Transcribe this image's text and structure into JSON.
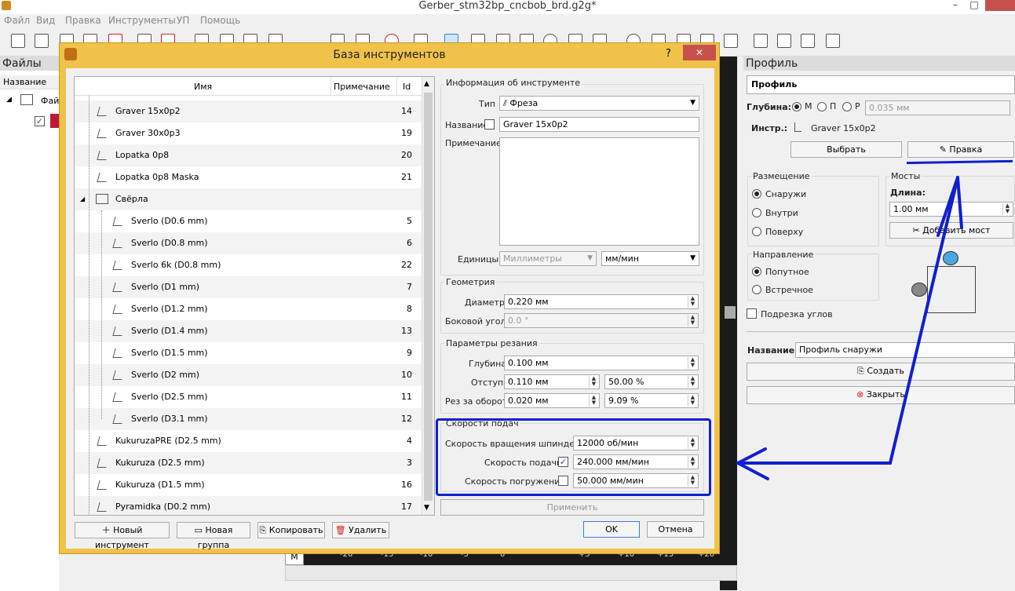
{
  "window": {
    "title": "Gerber_stm32bp_cncbob_brd.g2g*"
  },
  "menu": [
    "Файл",
    "Вид",
    "Правка",
    "Инструменты",
    "УП",
    "Помощь"
  ],
  "left_panel": {
    "title": "Файлы",
    "column": "Название",
    "tree_item": "Файл"
  },
  "dialog": {
    "title": "База инструментов",
    "help": "?",
    "close": "✕",
    "columns": {
      "name": "Имя",
      "note": "Примечание",
      "id": "Id"
    },
    "rows": [
      {
        "name": "Graver 15x0p2",
        "id": "14",
        "level": 1
      },
      {
        "name": "Graver 30x0p3",
        "id": "19",
        "level": 1
      },
      {
        "name": "Lopatka 0p8",
        "id": "20",
        "level": 1
      },
      {
        "name": "Lopatka 0p8 Maska",
        "id": "21",
        "level": 1
      },
      {
        "name": "Свёрла",
        "id": "",
        "level": 0,
        "group": true
      },
      {
        "name": "Sverlo (D0.6 mm)",
        "id": "5",
        "level": 2
      },
      {
        "name": "Sverlo (D0.8 mm)",
        "id": "6",
        "level": 2
      },
      {
        "name": "Sverlo 6k (D0.8 mm)",
        "id": "22",
        "level": 2
      },
      {
        "name": "Sverlo (D1 mm)",
        "id": "7",
        "level": 2
      },
      {
        "name": "Sverlo (D1.2 mm)",
        "id": "8",
        "level": 2
      },
      {
        "name": "Sverlo (D1.4 mm)",
        "id": "13",
        "level": 2
      },
      {
        "name": "Sverlo (D1.5 mm)",
        "id": "9",
        "level": 2
      },
      {
        "name": "Sverlo (D2 mm)",
        "id": "10",
        "level": 2
      },
      {
        "name": "Sverlo (D2.5 mm)",
        "id": "11",
        "level": 2
      },
      {
        "name": "Sverlo (D3.1 mm)",
        "id": "12",
        "level": 2
      },
      {
        "name": "KukuruzaPRE (D2.5 mm)",
        "id": "4",
        "level": 1
      },
      {
        "name": "Kukuruza (D2.5 mm)",
        "id": "3",
        "level": 1
      },
      {
        "name": "Kukuruza (D1.5 mm)",
        "id": "16",
        "level": 1
      },
      {
        "name": "Pyramidka (D0.2 mm)",
        "id": "17",
        "level": 1
      }
    ],
    "info": {
      "group": "Информация об инструменте",
      "type_label": "Тип",
      "type_value": "Фреза",
      "name_label": "Название",
      "name_value": "Graver 15x0p2",
      "note_label": "Примечание",
      "units_label": "Единицы",
      "units_value": "Миллиметры",
      "speed_units": "мм/мин"
    },
    "geometry": {
      "group": "Геометрия",
      "diameter_label": "Диаметр",
      "diameter_value": "0.220 мм",
      "angle_label": "Боковой угол",
      "angle_value": "0.0 °"
    },
    "cutting": {
      "group": "Параметры резания",
      "depth_label": "Глубина",
      "depth_value": "0.100 мм",
      "stepover_label": "Отступ",
      "stepover_value": "0.110 мм",
      "stepover_pct": "50.00 %",
      "feedrev_label": "Рез за оборот",
      "feedrev_value": "0.020 мм",
      "feedrev_pct": "9.09 %"
    },
    "feeds": {
      "group": "Скорости подач",
      "spindle_label": "Скорость вращения шпинделя",
      "spindle_value": "12000 об/мин",
      "feed_label": "Скорость подачи",
      "feed_value": "240.000 мм/мин",
      "plunge_label": "Скорость погружения",
      "plunge_value": "50.000 мм/мин"
    },
    "apply": "Применить",
    "buttons": {
      "new_tool": "Новый инструмент",
      "new_group": "Новая группа",
      "copy": "Копировать",
      "delete": "Удалить",
      "ok": "OK",
      "cancel": "Отмена"
    }
  },
  "profile": {
    "title": "Профиль",
    "header": "Профиль",
    "depth_label": "Глубина:",
    "m": "М",
    "p": "П",
    "r": "Р",
    "depth_value": "0.035 мм",
    "tool_label": "Инстр.:",
    "tool_value": "Graver 15x0p2",
    "select_btn": "Выбрать",
    "edit_btn": "Правка",
    "placement": "Размещение",
    "outside": "Снаружи",
    "inside": "Внутри",
    "on": "Поверху",
    "bridges": "Мосты",
    "length_label": "Длина:",
    "length_value": "1.00 мм",
    "add_bridge": "Добавить мост",
    "direction": "Направление",
    "climb": "Попутное",
    "conventional": "Встречное",
    "corner": "Подрезка углов",
    "name_label": "Название:",
    "name_value": "Профиль снаружи",
    "create": "Создать",
    "close": "Закрыть"
  },
  "ruler": {
    "m": "M",
    "ticks": [
      "-20",
      "-15",
      "-10",
      "-5",
      "0",
      "+5",
      "+10",
      "+15",
      "+20",
      "+25"
    ]
  }
}
